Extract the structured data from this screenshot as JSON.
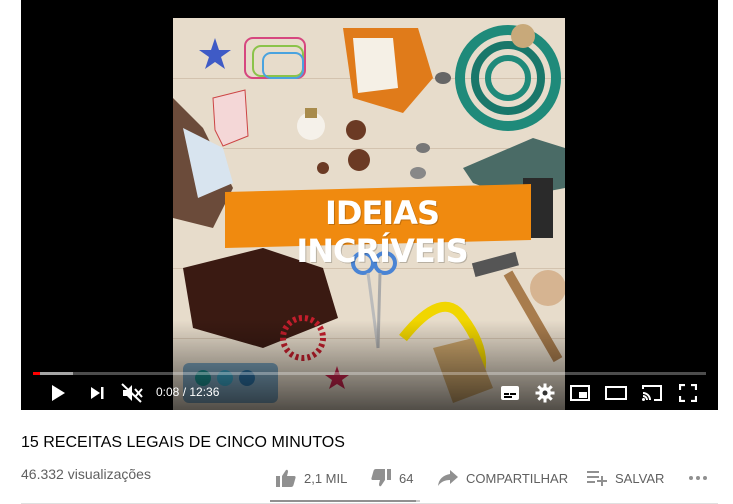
{
  "video": {
    "thumbnail_text": "IDEIAS INCRÍVEIS",
    "time_current": "0:08",
    "time_total": "12:36",
    "time_separator": " / ",
    "progress_fraction": 0.011,
    "buffer_fraction": 0.06,
    "accent_color": "#ff0000"
  },
  "info": {
    "title": "15 RECEITAS LEGAIS DE CINCO MINUTOS",
    "views": "46.332 visualizações"
  },
  "actions": {
    "like_count": "2,1 MIL",
    "dislike_count": "64",
    "share_label": "COMPARTILHAR",
    "save_label": "SALVAR",
    "like_fraction": 0.97
  }
}
